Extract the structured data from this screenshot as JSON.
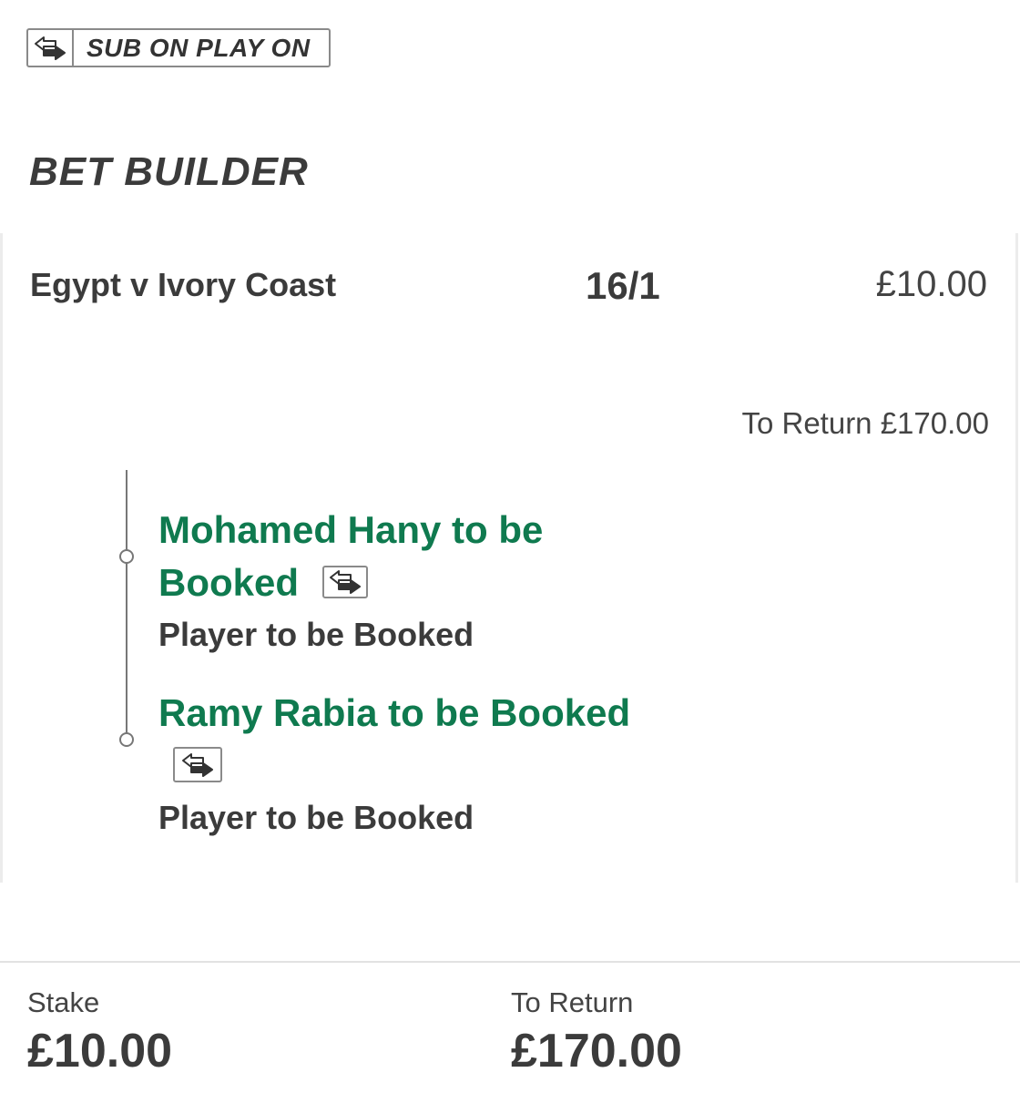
{
  "badge": {
    "icon": "swap-arrows-icon",
    "label": "SUB ON PLAY ON"
  },
  "section_title": "BET BUILDER",
  "bet": {
    "match": "Egypt v Ivory Coast",
    "odds": "16/1",
    "stake": "£10.00",
    "to_return": "To Return £170.00"
  },
  "legs": [
    {
      "title_line1": "Mohamed Hany to be",
      "title_line2": "Booked",
      "market": "Player to be Booked",
      "icon": "swap-arrows-icon"
    },
    {
      "title_line1": "Ramy Rabia to be Booked",
      "market": "Player to be Booked",
      "icon": "swap-arrows-icon"
    }
  ],
  "footer": {
    "stake_label": "Stake",
    "stake_value": "£10.00",
    "return_label": "To Return",
    "return_value": "£170.00"
  },
  "colors": {
    "accent_green": "#0f7a4f",
    "text_dark": "#3b3b3b",
    "border_grey": "#8a8a8a"
  }
}
